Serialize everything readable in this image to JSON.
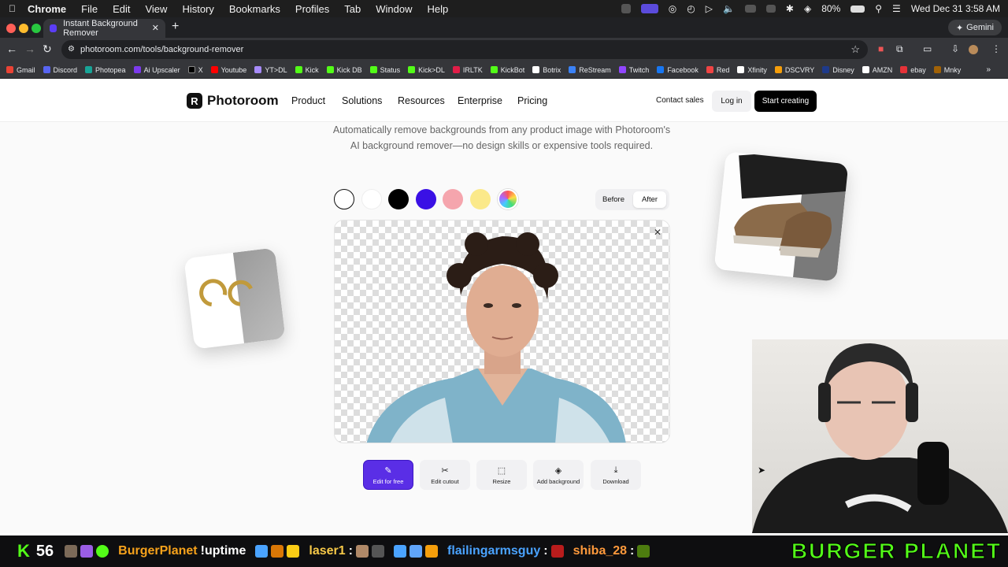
{
  "menubar": {
    "app": "Chrome",
    "items": [
      "File",
      "Edit",
      "View",
      "History",
      "Bookmarks",
      "Profiles",
      "Tab",
      "Window",
      "Help"
    ],
    "battery": "80%",
    "datetime": "Wed Dec 31  3:58 AM"
  },
  "browser": {
    "tab_title": "Instant Background Remover",
    "url": "photoroom.com/tools/background-remover",
    "gemini_label": "Gemini",
    "bookmarks": [
      {
        "label": "Gmail",
        "color": "#ea4335"
      },
      {
        "label": "Discord",
        "color": "#5865f2"
      },
      {
        "label": "Photopea",
        "color": "#18a497"
      },
      {
        "label": "Ai Upscaler",
        "color": "#7c3aed"
      },
      {
        "label": "X",
        "color": "#000000"
      },
      {
        "label": "Youtube",
        "color": "#ff0000"
      },
      {
        "label": "YT>DL",
        "color": "#a78bfa"
      },
      {
        "label": "Kick",
        "color": "#53fc18"
      },
      {
        "label": "Kick DB",
        "color": "#53fc18"
      },
      {
        "label": "Status",
        "color": "#53fc18"
      },
      {
        "label": "Kick>DL",
        "color": "#53fc18"
      },
      {
        "label": "IRLTK",
        "color": "#e11d48"
      },
      {
        "label": "KickBot",
        "color": "#53fc18"
      },
      {
        "label": "Botrix",
        "color": "#ffffff"
      },
      {
        "label": "ReStream",
        "color": "#3b82f6"
      },
      {
        "label": "Twitch",
        "color": "#9146ff"
      },
      {
        "label": "Facebook",
        "color": "#1877f2"
      },
      {
        "label": "Red",
        "color": "#ef4444"
      },
      {
        "label": "Xfinity",
        "color": "#ffffff"
      },
      {
        "label": "DSCVRY",
        "color": "#f59e0b"
      },
      {
        "label": "Disney",
        "color": "#1e3a8a"
      },
      {
        "label": "AMZN",
        "color": "#ffffff"
      },
      {
        "label": "ebay",
        "color": "#e53238"
      },
      {
        "label": "Mnky",
        "color": "#a16207"
      }
    ]
  },
  "site": {
    "brand": "Photoroom",
    "nav": [
      "Product",
      "Solutions",
      "Resources",
      "Enterprise",
      "Pricing"
    ],
    "contact": "Contact sales",
    "login": "Log in",
    "start": "Start creating",
    "subtitle_line1": "Automatically remove backgrounds from any product image with Photoroom's",
    "subtitle_line2": "AI background remover—no design skills or expensive tools required.",
    "swatches": [
      "transparent",
      "#ffffff",
      "#000000",
      "#3a10e5",
      "#f5a5ad",
      "#fbe98a",
      "rainbow"
    ],
    "toggle": {
      "before": "Before",
      "after": "After"
    },
    "actions": [
      {
        "label": "Edit for free",
        "icon": "pencil-icon"
      },
      {
        "label": "Edit cutout",
        "icon": "scissors-icon"
      },
      {
        "label": "Resize",
        "icon": "resize-icon"
      },
      {
        "label": "Add background",
        "icon": "layers-icon"
      },
      {
        "label": "Download",
        "icon": "download-icon"
      }
    ]
  },
  "stream": {
    "viewers": "56",
    "chat": [
      {
        "user": "BurgerPlanet",
        "color": "#f7a21b",
        "message": "!uptime"
      },
      {
        "user": "laser1",
        "color": "#f7c948",
        "message": ""
      },
      {
        "user": "flailingarmsguy",
        "color": "#4aa3ff",
        "message": ""
      },
      {
        "user": "shiba_28",
        "color": "#ff9a3c",
        "message": ""
      }
    ],
    "brand": "BURGER PLANET"
  }
}
